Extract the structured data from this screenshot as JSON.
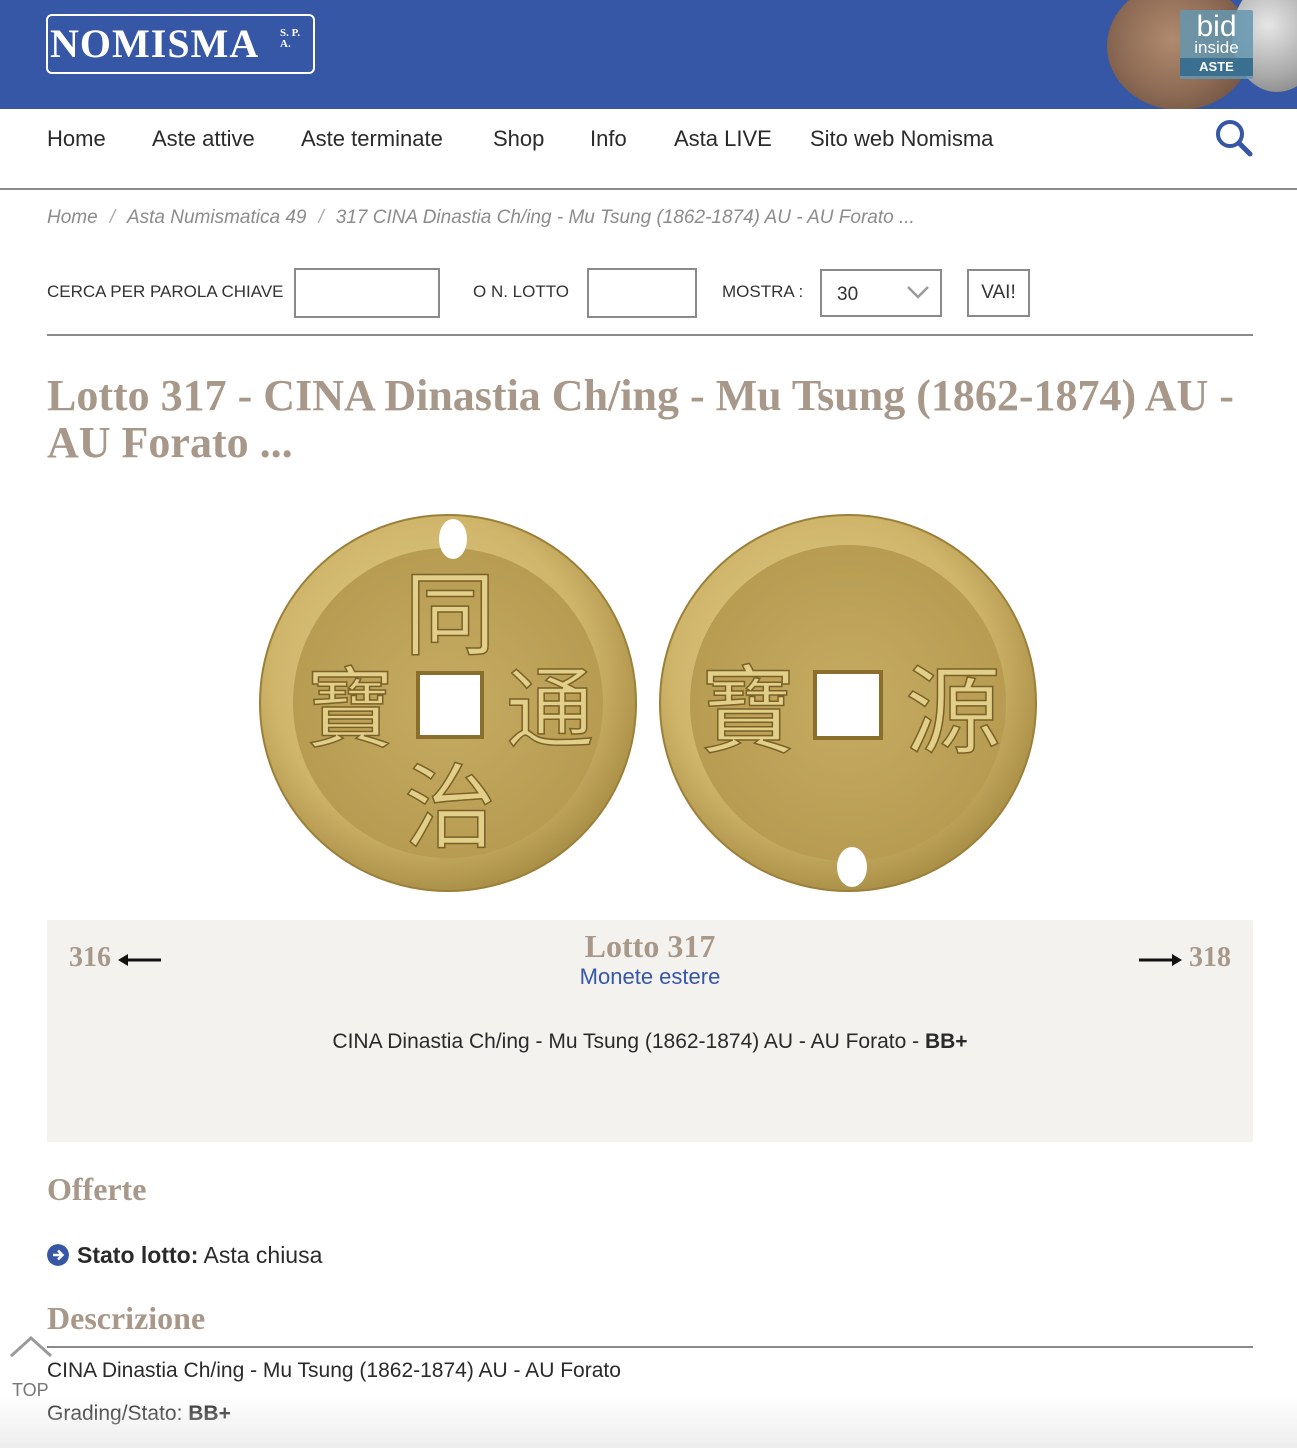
{
  "header": {
    "logo_main": "NOMISMA",
    "logo_suffix": "S. P. A.",
    "badge": {
      "line1": "bid",
      "line2": "inside",
      "line3": "ASTE"
    }
  },
  "nav": {
    "items": [
      "Home",
      "Aste attive",
      "Aste terminate",
      "Shop",
      "Info",
      "Asta LIVE",
      "Sito web Nomisma"
    ],
    "search_icon": "search-icon"
  },
  "breadcrumb": [
    "Home",
    "Asta Numismatica 49",
    "317 CINA Dinastia Ch/ing - Mu Tsung (1862-1874) AU - AU Forato ..."
  ],
  "search": {
    "keyword_label": "CERCA PER PAROLA CHIAVE",
    "keyword_value": "",
    "lot_label": "O N. LOTTO",
    "lot_value": "",
    "show_label": "MOSTRA :",
    "show_value": "30",
    "submit_label": "VAI!"
  },
  "lot": {
    "title": "Lotto 317 - CINA Dinastia Ch/ing - Mu Tsung (1862-1874) AU - AU Forato ...",
    "prev_number": "316",
    "next_number": "318",
    "label": "Lotto 317",
    "category": "Monete estere",
    "short_desc": "CINA Dinastia Ch/ing - Mu Tsung (1862-1874) AU - AU Forato - ",
    "short_grade": "BB+",
    "obverse_chars": [
      "同",
      "治",
      "通",
      "寶"
    ],
    "reverse_chars": [
      "寶",
      "源"
    ]
  },
  "offers": {
    "title": "Offerte",
    "status_label": "Stato lotto:",
    "status_value": "Asta chiusa"
  },
  "description": {
    "title": "Descrizione",
    "line1": "CINA Dinastia Ch/ing - Mu Tsung (1862-1874) AU - AU Forato",
    "grading_label": "Grading/Stato: ",
    "grading_value": "BB+"
  },
  "to_top_label": "TOP",
  "colors": {
    "brand_blue": "#3656a6",
    "title_taupe": "#a8988a",
    "panel_bg": "#f3f2ee",
    "coin_gold": "#d4bc72"
  }
}
